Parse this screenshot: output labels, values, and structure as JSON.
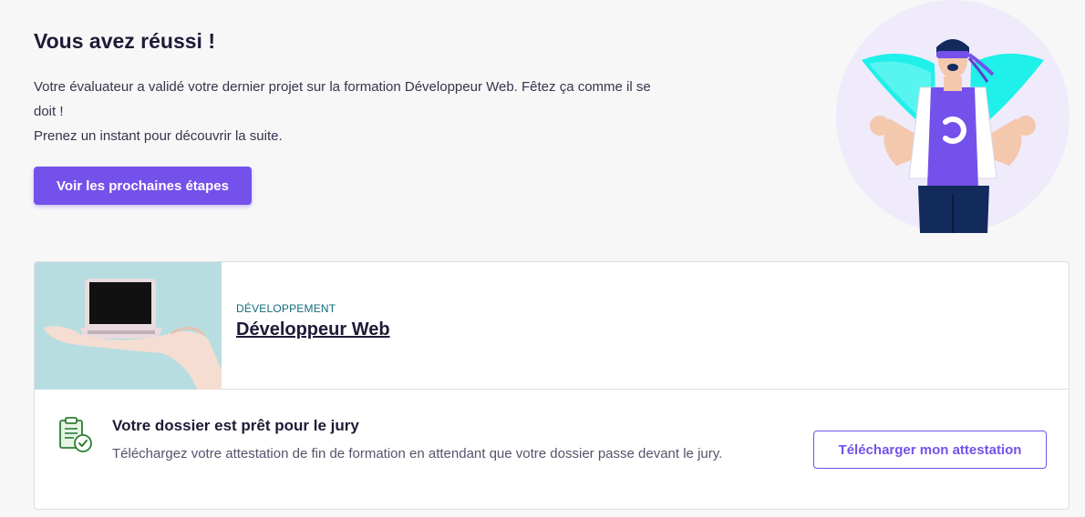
{
  "hero": {
    "title": "Vous avez réussi !",
    "line1": "Votre évaluateur a validé votre dernier projet sur la formation Développeur Web. Fêtez ça comme il se doit !",
    "line2": "Prenez un instant pour découvrir la suite.",
    "button_label": "Voir les prochaines étapes"
  },
  "course": {
    "category": "DÉVELOPPEMENT",
    "title": "Développeur Web"
  },
  "jury": {
    "title": "Votre dossier est prêt pour le jury",
    "text": "Téléchargez votre attestation de fin de formation en attendant que votre dossier passe devant le jury.",
    "button_label": "Télécharger mon attestation"
  },
  "colors": {
    "accent": "#7451eb",
    "category": "#136b7c",
    "success": "#2e7d32"
  }
}
